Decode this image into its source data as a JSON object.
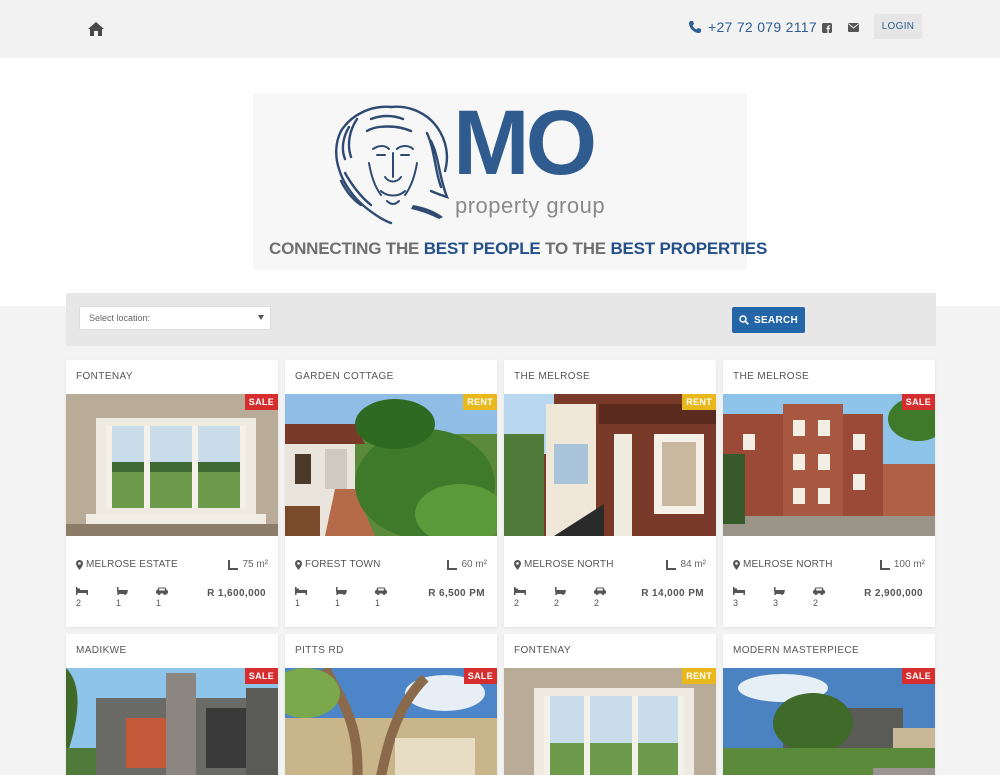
{
  "header": {
    "phone": "+27 72 079 2117",
    "login_label": "LOGIN"
  },
  "brand": {
    "logo_main": "MO",
    "logo_sub": "property group",
    "tagline": {
      "p1": "CONNECTING THE ",
      "p2": "BEST PEOPLE",
      "p3": " TO THE ",
      "p4": "BEST PROPERTIES"
    },
    "colors": {
      "primary": "#2f5b8f",
      "sale": "#d62e2e",
      "rent": "#e9b81c",
      "button": "#2466a8"
    }
  },
  "search": {
    "location_placeholder": "Select location:",
    "button_label": "SEARCH"
  },
  "listings": [
    {
      "title": "FONTENAY",
      "badge": "SALE",
      "location": "MELROSE ESTATE",
      "size": "75 m²",
      "beds": "2",
      "baths": "1",
      "garages": "1",
      "price": "R 1,600,000"
    },
    {
      "title": "GARDEN COTTAGE",
      "badge": "RENT",
      "location": "FOREST TOWN",
      "size": "60 m²",
      "beds": "1",
      "baths": "1",
      "garages": "1",
      "price": "R 6,500 PM"
    },
    {
      "title": "THE MELROSE",
      "badge": "RENT",
      "location": "MELROSE NORTH",
      "size": "84 m²",
      "beds": "2",
      "baths": "2",
      "garages": "2",
      "price": "R 14,000 PM"
    },
    {
      "title": "THE MELROSE",
      "badge": "SALE",
      "location": "MELROSE NORTH",
      "size": "100 m²",
      "beds": "3",
      "baths": "3",
      "garages": "2",
      "price": "R 2,900,000"
    },
    {
      "title": "MADIKWE",
      "badge": "SALE"
    },
    {
      "title": "PITTS RD",
      "badge": "SALE"
    },
    {
      "title": "FONTENAY",
      "badge": "RENT"
    },
    {
      "title": "MODERN MASTERPIECE",
      "badge": "SALE"
    }
  ]
}
